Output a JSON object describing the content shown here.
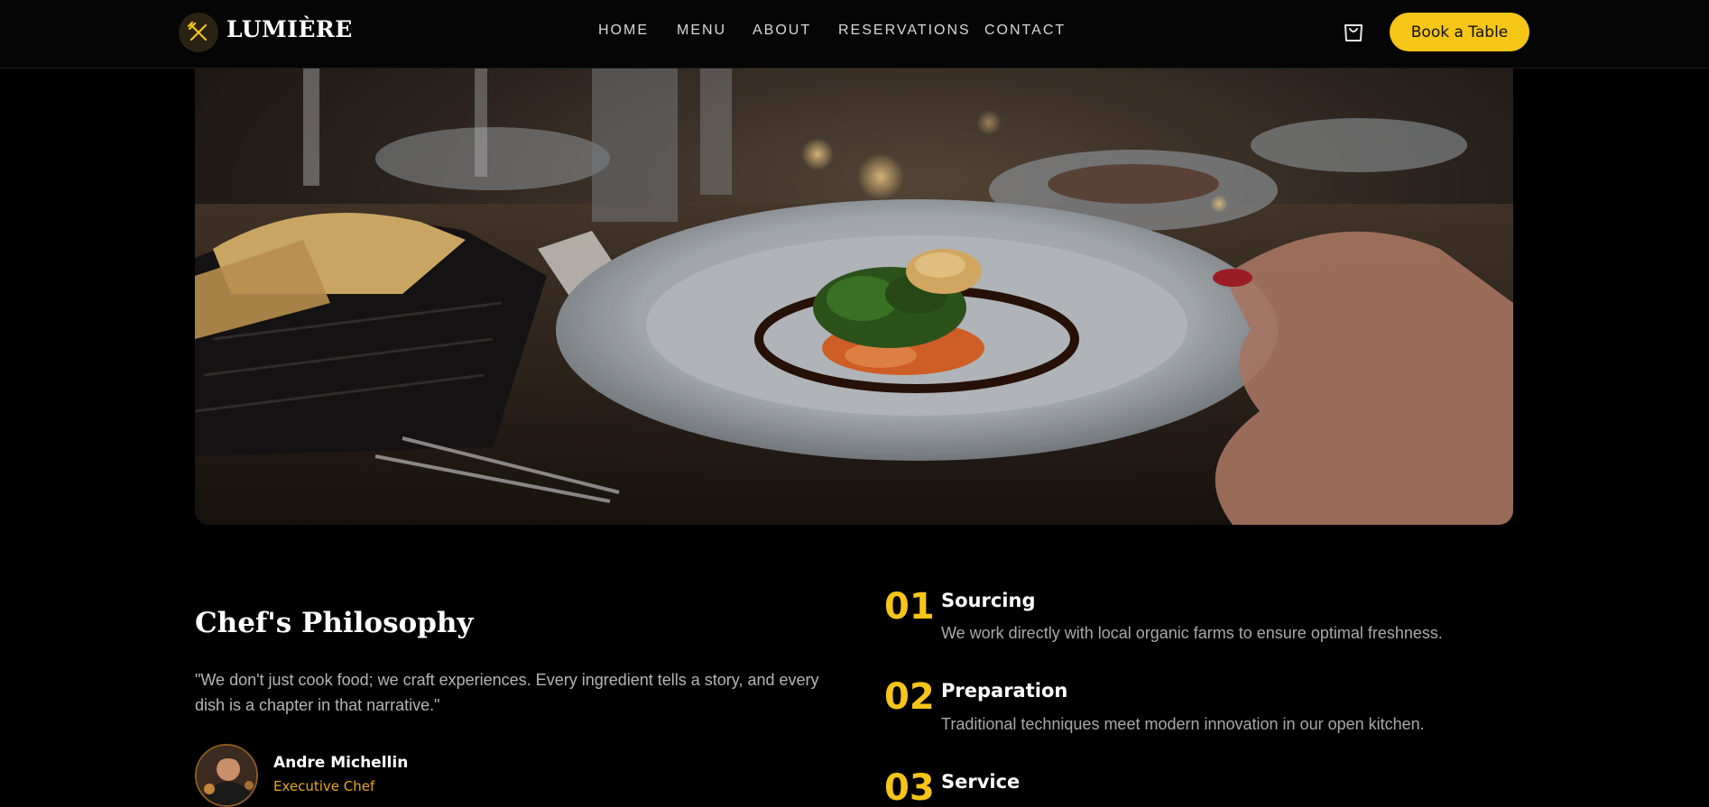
{
  "brand": {
    "name": "LUMIÈRE",
    "icon": "crossed-utensils-icon",
    "accent": "#f5c518"
  },
  "nav": {
    "items": [
      {
        "label": "HOME"
      },
      {
        "label": "MENU"
      },
      {
        "label": "ABOUT"
      },
      {
        "label": "RESERVATIONS"
      },
      {
        "label": "CONTACT"
      }
    ],
    "cart_icon": "shopping-bag-icon",
    "cta_label": "Book a Table"
  },
  "hero": {
    "image": "plated-dish-on-restaurant-table-photo"
  },
  "philosophy": {
    "title": "Chef's Philosophy",
    "quote": "\"We don't just cook food; we craft experiences. Every ingredient tells a story, and every dish is a chapter in that narrative.\"",
    "chef": {
      "name": "Andre Michellin",
      "role": "Executive Chef"
    }
  },
  "steps": [
    {
      "number": "01",
      "title": "Sourcing",
      "text": "We work directly with local organic farms to ensure optimal freshness."
    },
    {
      "number": "02",
      "title": "Preparation",
      "text": "Traditional techniques meet modern innovation in our open kitchen."
    },
    {
      "number": "03",
      "title": "Service",
      "text": ""
    }
  ]
}
